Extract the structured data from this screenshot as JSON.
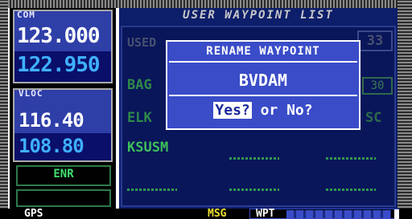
{
  "com": {
    "label": "COM",
    "active_freq": "123.000",
    "standby_freq": "122.950"
  },
  "vloc": {
    "label": "VLOC",
    "active_freq": "116.40",
    "standby_freq": "108.80"
  },
  "cdi_mode": "ENR",
  "page": {
    "title": "USER WAYPOINT LIST",
    "used_label": "USED",
    "used_count": "33",
    "waypoints": [
      "BAG",
      "ELK",
      "KSUSM"
    ],
    "right_col": [
      "30",
      "SC"
    ]
  },
  "popup": {
    "title": "RENAME WAYPOINT",
    "name": "BVDAM",
    "yes": "Yes?",
    "or_no": " or No?"
  },
  "status": {
    "gps": "GPS",
    "msg": "MSG",
    "mode": "WPT"
  },
  "colors": {
    "accent_blue": "#3a4cc8",
    "standby_cyan": "#3fb0ff",
    "waypoint_green": "#3fbf5a",
    "msg_yellow": "#f0e030"
  }
}
